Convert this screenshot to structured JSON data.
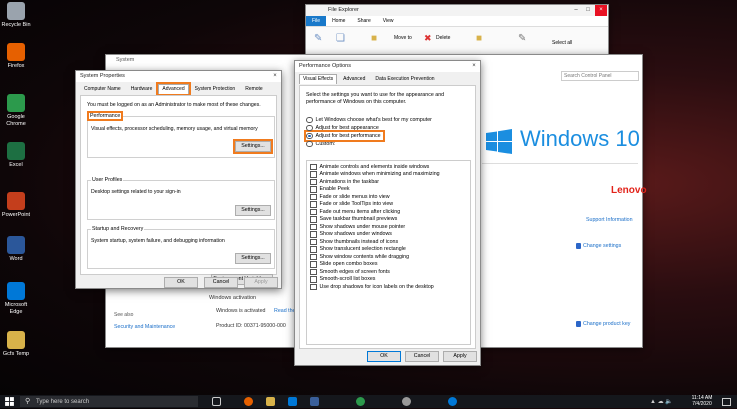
{
  "desktop": {
    "icons": [
      {
        "label": "Recycle Bin",
        "icon": "recycle-bin-icon",
        "color": "#9aa3ad"
      },
      {
        "label": "Firefox",
        "icon": "firefox-icon",
        "color": "#e66000"
      },
      {
        "label": "Google Chrome",
        "icon": "chrome-icon",
        "color": "#2c9a4c"
      },
      {
        "label": "Excel",
        "icon": "excel-icon",
        "color": "#1d6f42"
      },
      {
        "label": "PowerPoint",
        "icon": "powerpoint-icon",
        "color": "#c43e1c"
      },
      {
        "label": "Word",
        "icon": "word-icon",
        "color": "#2b579a"
      },
      {
        "label": "Microsoft Edge",
        "icon": "edge-icon",
        "color": "#0078d7"
      },
      {
        "label": "Gcfs Temp",
        "icon": "folder-icon",
        "color": "#d8b24a"
      }
    ]
  },
  "explorer": {
    "title": "File Explorer",
    "ribbon_tabs": [
      "File",
      "Home",
      "Share",
      "View"
    ],
    "ribbon_items": [
      "Move to",
      "Delete",
      "Select all"
    ]
  },
  "system_window": {
    "title": "System",
    "search_placeholder": "Search Control Panel",
    "brand": "Windows 10",
    "oem": "Lenovo",
    "support_link": "Support Information",
    "change_settings": "Change settings",
    "change_product_key": "Change product key",
    "activation_header": "Windows activation",
    "activation_text": "Windows is activated",
    "read_link": "Read the",
    "product_id": "Product ID: 00371-95000-000",
    "see_also": "See also",
    "security_maintenance": "Security and Maintenance"
  },
  "system_properties": {
    "title": "System Properties",
    "tabs": [
      "Computer Name",
      "Hardware",
      "Advanced",
      "System Protection",
      "Remote"
    ],
    "admin_note": "You must be logged on as an Administrator to make most of these changes.",
    "performance_label": "Performance",
    "performance_desc": "Visual effects, processor scheduling, memory usage, and virtual memory",
    "settings_btn": "Settings...",
    "user_profiles_label": "User Profiles",
    "user_profiles_desc": "Desktop settings related to your sign-in",
    "startup_label": "Startup and Recovery",
    "startup_desc": "System startup, system failure, and debugging information",
    "env_btn": "Environment Variables...",
    "ok": "OK",
    "cancel": "Cancel",
    "apply": "Apply"
  },
  "performance_options": {
    "title": "Performance Options",
    "tabs": [
      "Visual Effects",
      "Advanced",
      "Data Execution Prevention"
    ],
    "intro": "Select the settings you want to use for the appearance and performance of Windows on this computer.",
    "radios": [
      {
        "label": "Let Windows choose what's best for my computer",
        "selected": false
      },
      {
        "label": "Adjust for best appearance",
        "selected": false
      },
      {
        "label": "Adjust for best performance",
        "selected": true
      },
      {
        "label": "Custom:",
        "selected": false
      }
    ],
    "effects": [
      "Animate controls and elements inside windows",
      "Animate windows when minimizing and maximizing",
      "Animations in the taskbar",
      "Enable Peek",
      "Fade or slide menus into view",
      "Fade or slide ToolTips into view",
      "Fade out menu items after clicking",
      "Save taskbar thumbnail previews",
      "Show shadows under mouse pointer",
      "Show shadows under windows",
      "Show thumbnails instead of icons",
      "Show translucent selection rectangle",
      "Show window contents while dragging",
      "Slide open combo boxes",
      "Smooth edges of screen fonts",
      "Smooth-scroll list boxes",
      "Use drop shadows for icon labels on the desktop"
    ],
    "ok": "OK",
    "cancel": "Cancel",
    "apply": "Apply"
  },
  "taskbar": {
    "search_placeholder": "Type here to search",
    "time": "11:14 AM",
    "date": "7/4/2020"
  },
  "colors": {
    "highlight": "#f07b1e",
    "accent": "#1b6fc9"
  }
}
